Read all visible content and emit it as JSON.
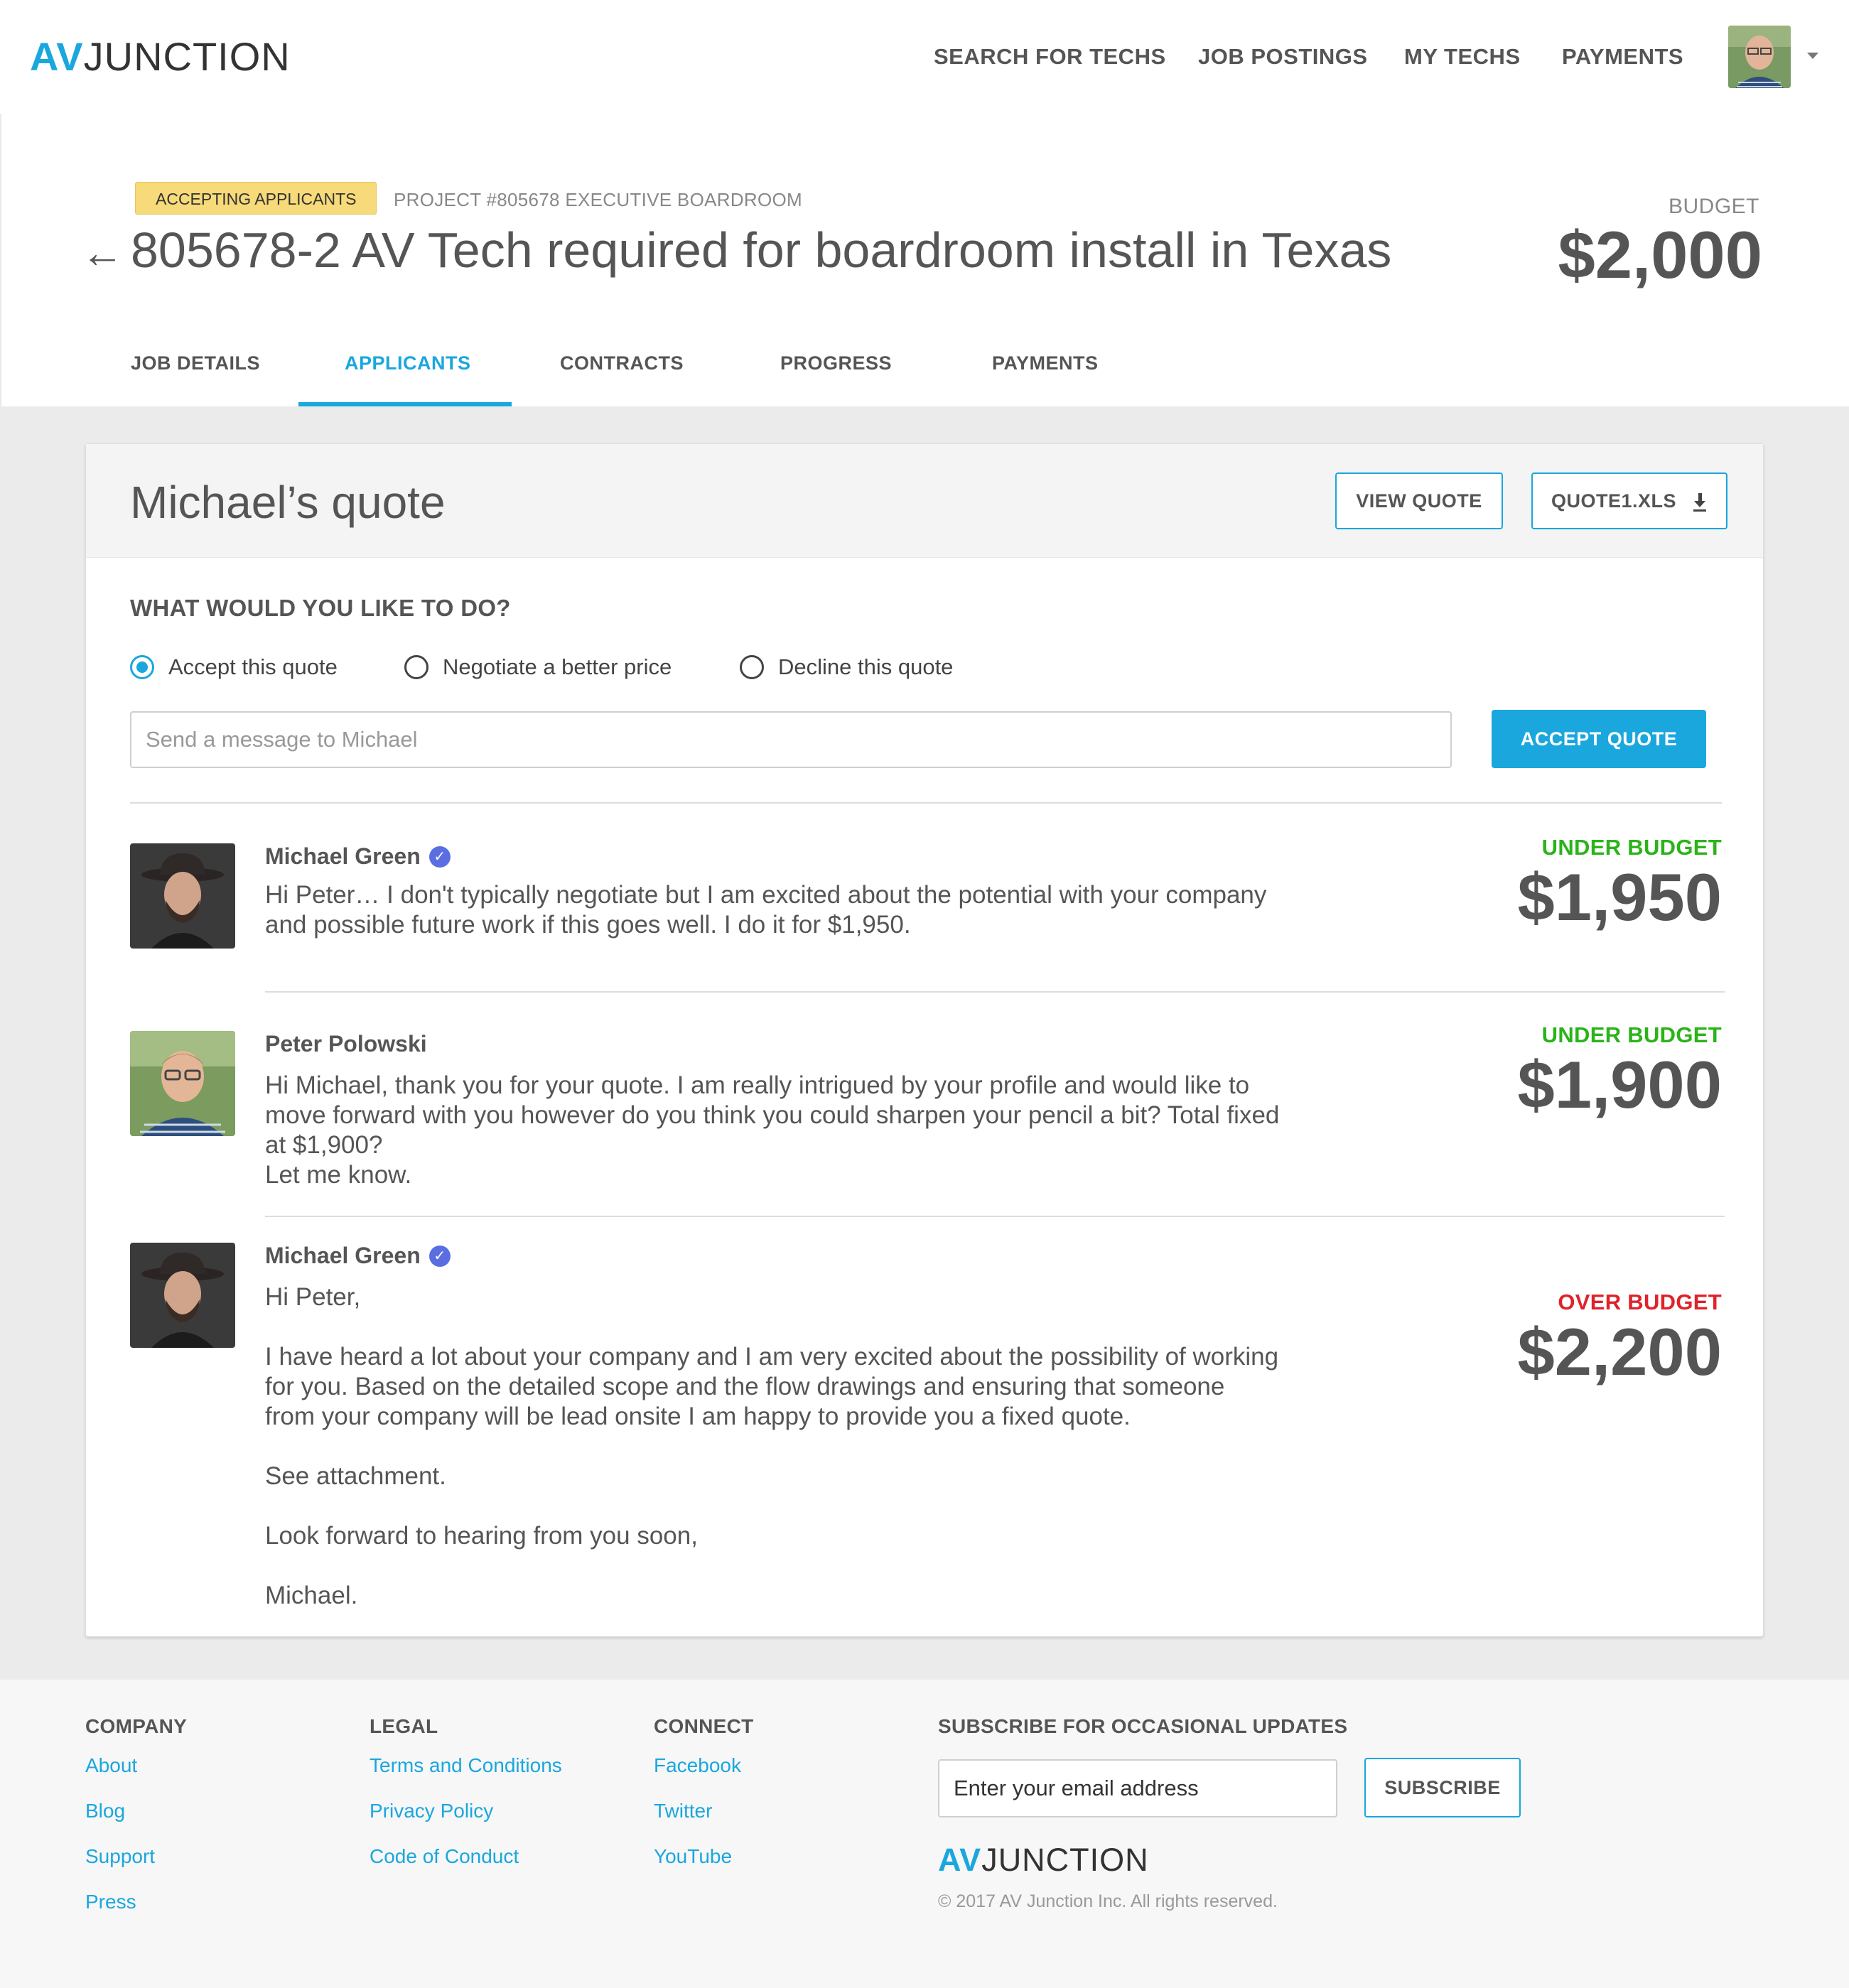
{
  "brand": {
    "av": "AV",
    "junction": "JUNCTION",
    "accent": "#1aa7de"
  },
  "nav": {
    "items": [
      {
        "label": "SEARCH FOR TECHS"
      },
      {
        "label": "JOB POSTINGS"
      },
      {
        "label": "MY TECHS"
      },
      {
        "label": "PAYMENTS"
      }
    ],
    "avatar_icon": "user-avatar",
    "menu_icon": "caret-down-icon"
  },
  "job": {
    "status_badge": "ACCEPTING APPLICANTS",
    "project_ref": "PROJECT #805678 EXECUTIVE BOARDROOM",
    "back_icon": "←",
    "title": "805678-2 AV Tech required for boardroom install in Texas",
    "budget_label": "BUDGET",
    "budget_value": "$2,000"
  },
  "tabs": [
    {
      "label": "JOB DETAILS"
    },
    {
      "label": "APPLICANTS",
      "active": true
    },
    {
      "label": "CONTRACTS"
    },
    {
      "label": "PROGRESS"
    },
    {
      "label": "PAYMENTS"
    }
  ],
  "quote": {
    "title": "Michael’s quote",
    "view_button": "VIEW QUOTE",
    "file_button": "QUOTE1.XLS",
    "question": "WHAT WOULD YOU LIKE TO DO?",
    "options": [
      {
        "label": "Accept this quote",
        "checked": true
      },
      {
        "label": "Negotiate a better price",
        "checked": false
      },
      {
        "label": "Decline this quote",
        "checked": false
      }
    ],
    "message_placeholder": "Send a message to Michael",
    "accept_button": "ACCEPT QUOTE"
  },
  "messages": [
    {
      "name": "Michael Green",
      "verified": true,
      "lines": [
        "Hi Peter… I don't typically negotiate but I am excited about the potential with your company",
        "and possible future work if this goes well.  I do it for $1,950."
      ],
      "status": "UNDER BUDGET",
      "amount": "$1,950"
    },
    {
      "name": "Peter Polowski",
      "verified": false,
      "lines": [
        "Hi Michael, thank you for your quote.  I am really intrigued by your profile and would like to",
        "move forward with you however do you think you could sharpen your pencil a bit?  Total fixed",
        "at $1,900?",
        "Let me know."
      ],
      "status": "UNDER BUDGET",
      "amount": "$1,900"
    },
    {
      "name": "Michael Green",
      "verified": true,
      "lines": [
        "Hi Peter,",
        "",
        "I have heard a lot about your company and I am very excited about the possibility of working",
        "for you.  Based on the detailed scope and the flow drawings and ensuring that someone",
        "from your company will be lead onsite I am happy to provide you a fixed quote.",
        "",
        "See attachment.",
        "",
        "Look forward to hearing from you soon,",
        "",
        "Michael."
      ],
      "status": "OVER BUDGET",
      "amount": "$2,200"
    }
  ],
  "colors": {
    "under_budget": "#2bb31a",
    "over_budget": "#e0222a",
    "badge": "#f7da79"
  },
  "footer": {
    "company": {
      "heading": "COMPANY",
      "links": [
        "About",
        "Blog",
        "Support",
        "Press"
      ]
    },
    "legal": {
      "heading": "LEGAL",
      "links": [
        "Terms and Conditions",
        "Privacy Policy",
        "Code of Conduct"
      ]
    },
    "connect": {
      "heading": "CONNECT",
      "links": [
        "Facebook",
        "Twitter",
        "YouTube"
      ]
    },
    "subscribe": {
      "heading": "SUBSCRIBE FOR OCCASIONAL UPDATES",
      "placeholder": "Enter your email address",
      "button": "SUBSCRIBE"
    },
    "copyright": "© 2017 AV Junction Inc. All rights reserved."
  }
}
